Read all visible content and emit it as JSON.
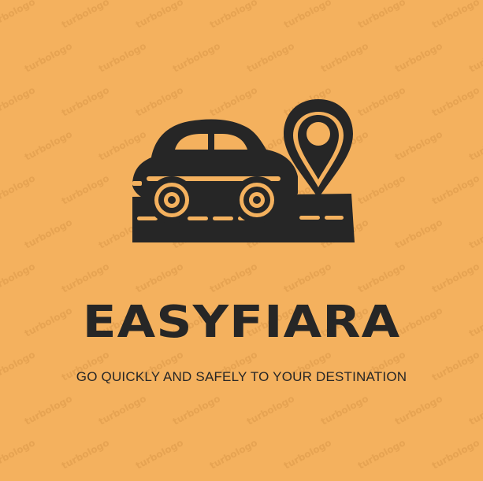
{
  "logo": {
    "brand_name": "EASYFIARA",
    "tagline": "GO QUICKLY AND SAFELY TO YOUR DESTINATION",
    "icon": "car-on-road-with-location-pin-icon"
  },
  "watermark": {
    "text": "turbologo"
  },
  "colors": {
    "background": "#F4B15E",
    "ink": "#262626",
    "watermark": "#E6A352"
  }
}
